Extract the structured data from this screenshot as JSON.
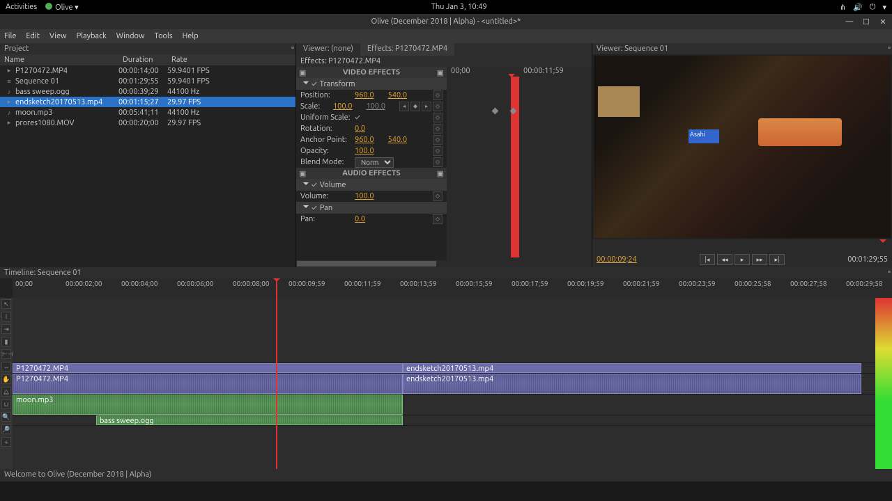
{
  "desktop": {
    "activities": "Activities",
    "app_menu": "Olive ▾",
    "clock": "Thu Jan  3, 10:49"
  },
  "window": {
    "title": "Olive (December 2018 | Alpha) - <untitled>*"
  },
  "menubar": [
    "File",
    "Edit",
    "View",
    "Playback",
    "Window",
    "Tools",
    "Help"
  ],
  "project": {
    "title": "Project",
    "columns": {
      "name": "Name",
      "duration": "Duration",
      "rate": "Rate"
    },
    "items": [
      {
        "icon": "▸",
        "name": "P1270472.MP4",
        "duration": "00:00:14;00",
        "rate": "59.9401 FPS",
        "selected": false
      },
      {
        "icon": "≡",
        "name": "Sequence 01",
        "duration": "00:01:29;55",
        "rate": "59.9401 FPS",
        "selected": false
      },
      {
        "icon": "♪",
        "name": "bass sweep.ogg",
        "duration": "00:00:39;29",
        "rate": "44100 Hz",
        "selected": false
      },
      {
        "icon": "▸",
        "name": "endsketch20170513.mp4",
        "duration": "00:01:15;27",
        "rate": "29.97 FPS",
        "selected": true
      },
      {
        "icon": "♪",
        "name": "moon.mp3",
        "duration": "00:05:41;11",
        "rate": "44100 Hz",
        "selected": false
      },
      {
        "icon": "▸",
        "name": "prores1080.MOV",
        "duration": "00:00:20;00",
        "rate": "29.97 FPS",
        "selected": false
      }
    ]
  },
  "effects": {
    "tabs": {
      "viewer": "Viewer: (none)",
      "effects": "Effects: P1270472.MP4"
    },
    "subtitle": "Effects: P1270472.MP4",
    "video_header": "VIDEO EFFECTS",
    "audio_header": "AUDIO EFFECTS",
    "transform": {
      "title": "Transform",
      "position": {
        "label": "Position:",
        "x": "960.0",
        "y": "540.0"
      },
      "scale": {
        "label": "Scale:",
        "x": "100.0",
        "y": "100.0"
      },
      "uniform": {
        "label": "Uniform Scale:",
        "checked": "✓"
      },
      "rotation": {
        "label": "Rotation:",
        "v": "0.0"
      },
      "anchor": {
        "label": "Anchor Point:",
        "x": "960.0",
        "y": "540.0"
      },
      "opacity": {
        "label": "Opacity:",
        "v": "100.0"
      },
      "blend": {
        "label": "Blend Mode:",
        "v": "Normal"
      }
    },
    "volume": {
      "title": "Volume",
      "label": "Volume:",
      "v": "100.0"
    },
    "pan": {
      "title": "Pan",
      "label": "Pan:",
      "v": "0.0"
    },
    "timecodes": {
      "start": "00;00",
      "end": "00:00:11;59"
    }
  },
  "viewer": {
    "title": "Viewer: Sequence 01",
    "timecode": "00:00:09;24",
    "duration": "00:01:29;55",
    "signs": {
      "asahi": "Asahi"
    }
  },
  "timeline": {
    "title": "Timeline: Sequence 01",
    "ruler_start": "00;00",
    "timestamps": [
      "00:00:02;00",
      "00:00:04;00",
      "00:00:06;00",
      "00:00:08;00",
      "00:00:09;59",
      "00:00:11;59",
      "00:00:13;59",
      "00:00:15;59",
      "00:00:17;59",
      "00:00:19;59",
      "00:00:21;59",
      "00:00:23;59",
      "00:00:25;58",
      "00:00:27;58",
      "00:00:29;58"
    ],
    "clips": {
      "v1a": "P1270472.MP4",
      "v1b": "endsketch20170513.mp4",
      "a1a": "P1270472.MP4",
      "a1b": "endsketch20170513.mp4",
      "a2": "moon.mp3",
      "a3": "bass sweep.ogg"
    }
  },
  "statusbar": "Welcome to Olive (December 2018 | Alpha)"
}
